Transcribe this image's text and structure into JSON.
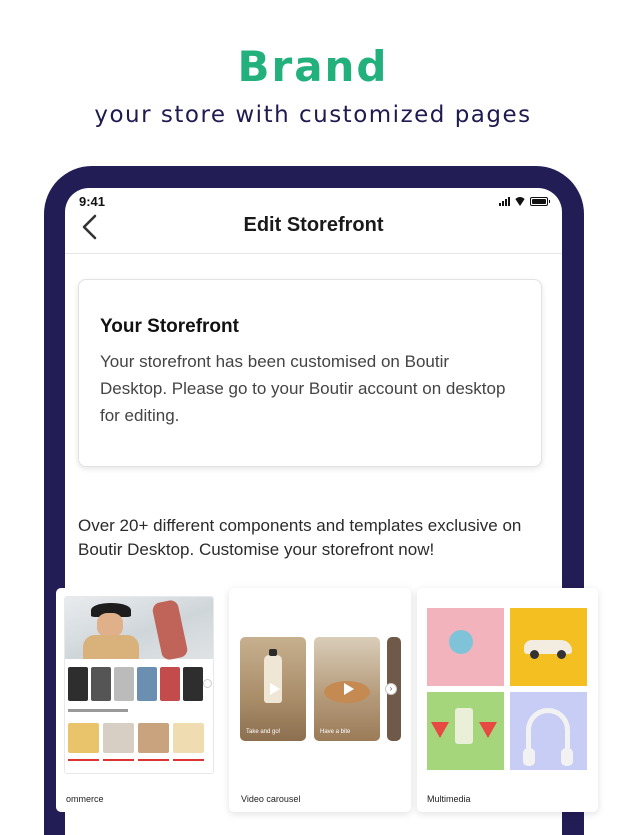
{
  "banner": {
    "headline": "Brand",
    "subline": "your store with customized pages"
  },
  "status_bar": {
    "time": "9:41"
  },
  "nav": {
    "back_icon": "chevron-left-icon",
    "title": "Edit Storefront"
  },
  "storefront_card": {
    "title": "Your Storefront",
    "body": "Your storefront has been customised on Boutir Desktop. Please go to your Boutir account on desktop for editing."
  },
  "promo_text": "Over 20+ different components and templates exclusive on Boutir Desktop. Customise your storefront now!",
  "templates": [
    {
      "label": "ommerce"
    },
    {
      "label": "Video carousel",
      "video_captions": [
        "Take and go!",
        "Have a bite"
      ]
    },
    {
      "label": "Multimedia"
    }
  ],
  "colors": {
    "brand_green": "#22b07d",
    "navy": "#221d55",
    "subline": "#1f1a4f"
  }
}
